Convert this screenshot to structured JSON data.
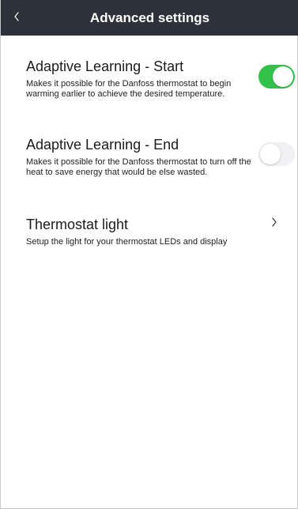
{
  "header": {
    "title": "Advanced settings",
    "back_icon": "chevron-left-icon"
  },
  "settings": [
    {
      "title": "Adaptive Learning - Start",
      "description": "Makes it possible for the Danfoss thermostat to begin warming earlier to achieve the desired temperature.",
      "control": "toggle",
      "enabled": true
    },
    {
      "title": "Adaptive Learning - End",
      "description": "Makes it possible for the Danfoss thermostat to turn off the heat to save energy that would be else wasted.",
      "control": "toggle",
      "enabled": false
    },
    {
      "title": "Thermostat light",
      "description": "Setup the light for your thermostat LEDs and display",
      "control": "chevron",
      "icon": "chevron-right-icon"
    }
  ],
  "colors": {
    "header_bg": "#2d3139",
    "toggle_on": "#33c14a",
    "toggle_off": "#f1f1f3"
  }
}
